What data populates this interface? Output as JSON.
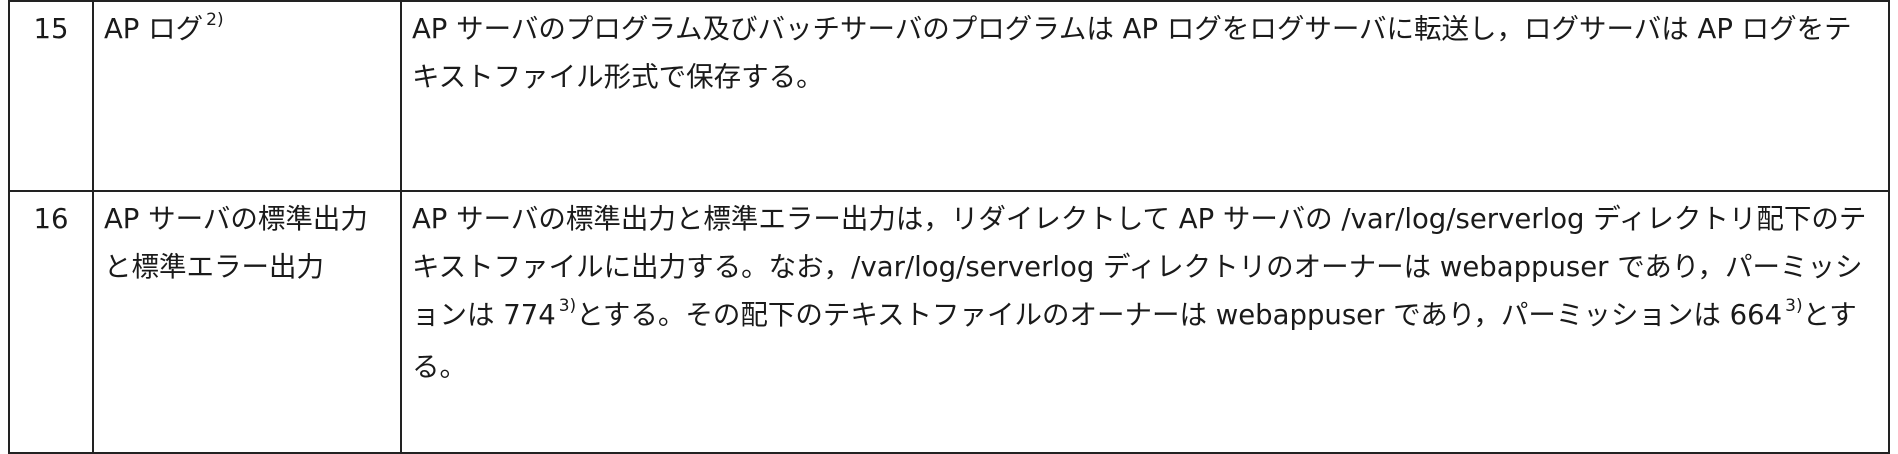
{
  "rows": [
    {
      "no": "15",
      "item": "AP ログ",
      "item_note": "2)",
      "description": "AP サーバのプログラム及びバッチサーバのプログラムは AP ログをログサーバに転送し，ログサーバは AP ログをテキストファイル形式で保存する。"
    },
    {
      "no": "16",
      "item": "AP サーバの標準出力と標準エラー出力",
      "description_part1": "AP サーバの標準出力と標準エラー出力は，リダイレクトして AP サーバの /var/log/serverlog ディレクトリ配下のテキストファイルに出力する。なお，/var/log/serverlog ディレクトリのオーナーは webappuser であり，パーミッションは 774",
      "note_a": "3)",
      "description_part2": "とする。その配下のテキストファイルのオーナーは webappuser であり，パーミッションは 664",
      "note_b": "3)",
      "description_part3": "とする。"
    }
  ]
}
